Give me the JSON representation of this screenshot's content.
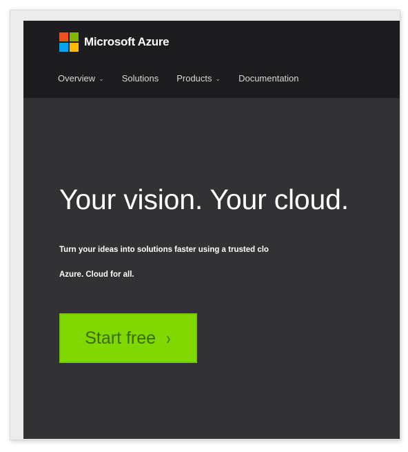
{
  "brand": {
    "name": "Microsoft Azure",
    "logo_colors": [
      "#f25022",
      "#7fba00",
      "#00a4ef",
      "#ffb900"
    ]
  },
  "nav": {
    "items": [
      {
        "label": "Overview",
        "has_dropdown": true
      },
      {
        "label": "Solutions",
        "has_dropdown": false
      },
      {
        "label": "Products",
        "has_dropdown": true
      },
      {
        "label": "Documentation",
        "has_dropdown": false
      }
    ],
    "chevron": "⌄"
  },
  "hero": {
    "title": "Your vision. Your cloud.",
    "subtitle_line1": "Turn your ideas into solutions faster using a trusted clo",
    "subtitle_line2": "Azure. Cloud for all.",
    "cta_label": "Start free",
    "cta_arrow": "›",
    "cta_color": "#7fd800"
  }
}
